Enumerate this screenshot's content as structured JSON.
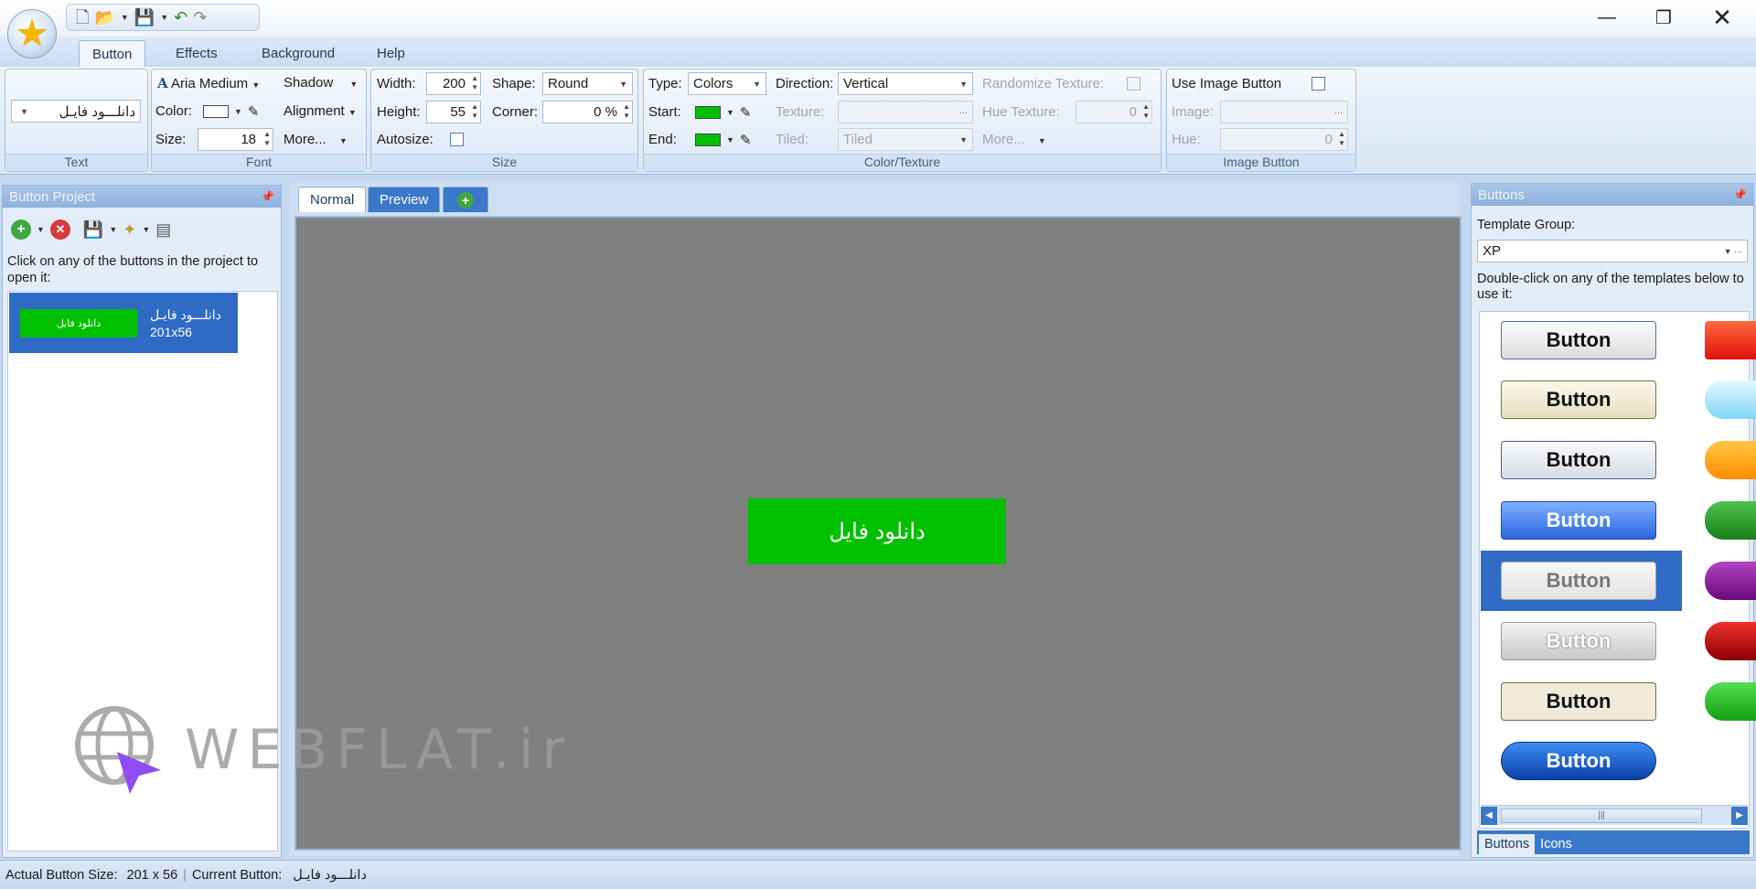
{
  "ribbon_tabs": [
    "Button",
    "Effects",
    "Background",
    "Help"
  ],
  "text_group": {
    "label": "Text",
    "value": "دانلـــود فایـل"
  },
  "font_group": {
    "label": "Font",
    "font_name": "Aria Medium",
    "shadow": "Shadow",
    "color_label": "Color:",
    "alignment": "Alignment",
    "size_label": "Size:",
    "size_value": "18",
    "more": "More..."
  },
  "size_group": {
    "label": "Size",
    "width_label": "Width:",
    "width_value": "200",
    "height_label": "Height:",
    "height_value": "55",
    "autosize_label": "Autosize:",
    "shape_label": "Shape:",
    "shape_value": "Round",
    "corner_label": "Corner:",
    "corner_value": "0 %"
  },
  "color_group": {
    "label": "Color/Texture",
    "type_label": "Type:",
    "type_value": "Colors",
    "start_label": "Start:",
    "end_label": "End:",
    "direction_label": "Direction:",
    "direction_value": "Vertical",
    "texture_label": "Texture:",
    "tiled_label": "Tiled:",
    "tiled_value": "Tiled",
    "randomize_label": "Randomize Texture:",
    "hue_texture_label": "Hue Texture:",
    "hue_texture_value": "0",
    "more": "More...",
    "swatch_color": "#00c000"
  },
  "image_group": {
    "label": "Image Button",
    "use_label": "Use Image Button",
    "image_label": "Image:",
    "hue_label": "Hue:",
    "hue_value": "0"
  },
  "left_panel": {
    "title": "Button Project",
    "hint": "Click on any of the buttons in the project to open it:",
    "item_button_text": "دانلود فایل",
    "item_name": "دانلـــود فایـل",
    "item_size": "201x56"
  },
  "center": {
    "tabs": [
      "Normal",
      "Preview"
    ],
    "button_text": "دانلود فایل",
    "button_color": "#00c000",
    "background": "#808080"
  },
  "right_panel": {
    "title": "Buttons",
    "group_label": "Template Group:",
    "group_value": "XP",
    "hint": "Double-click on any of the templates below to use it:",
    "template_label": "Button",
    "bottom_tabs": [
      "Buttons",
      "Icons"
    ]
  },
  "status": {
    "actual_label": "Actual Button Size:",
    "actual_value": "201 x 56",
    "current_label": "Current Button:",
    "current_value": "دانلـــود فایـل"
  },
  "watermark": "WEBFLAT.ir"
}
